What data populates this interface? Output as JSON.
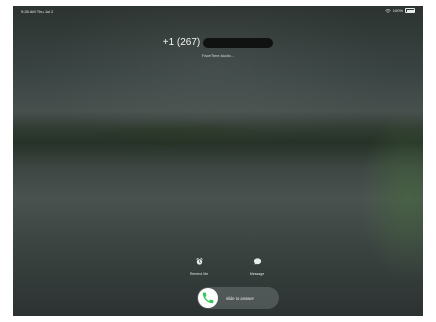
{
  "status_bar": {
    "time_day": "9:28 AM  Thu Jul 2",
    "battery_percent": "100%"
  },
  "call": {
    "number_prefix": "+1 (267)",
    "subtitle": "FaceTime Audio..."
  },
  "actions": [
    {
      "label": "Remind Me",
      "icon": "alarm-clock-icon"
    },
    {
      "label": "Message",
      "icon": "message-bubble-icon"
    }
  ],
  "slide": {
    "label": "slide to answer",
    "icon": "phone-icon",
    "accent": "#34c759"
  }
}
